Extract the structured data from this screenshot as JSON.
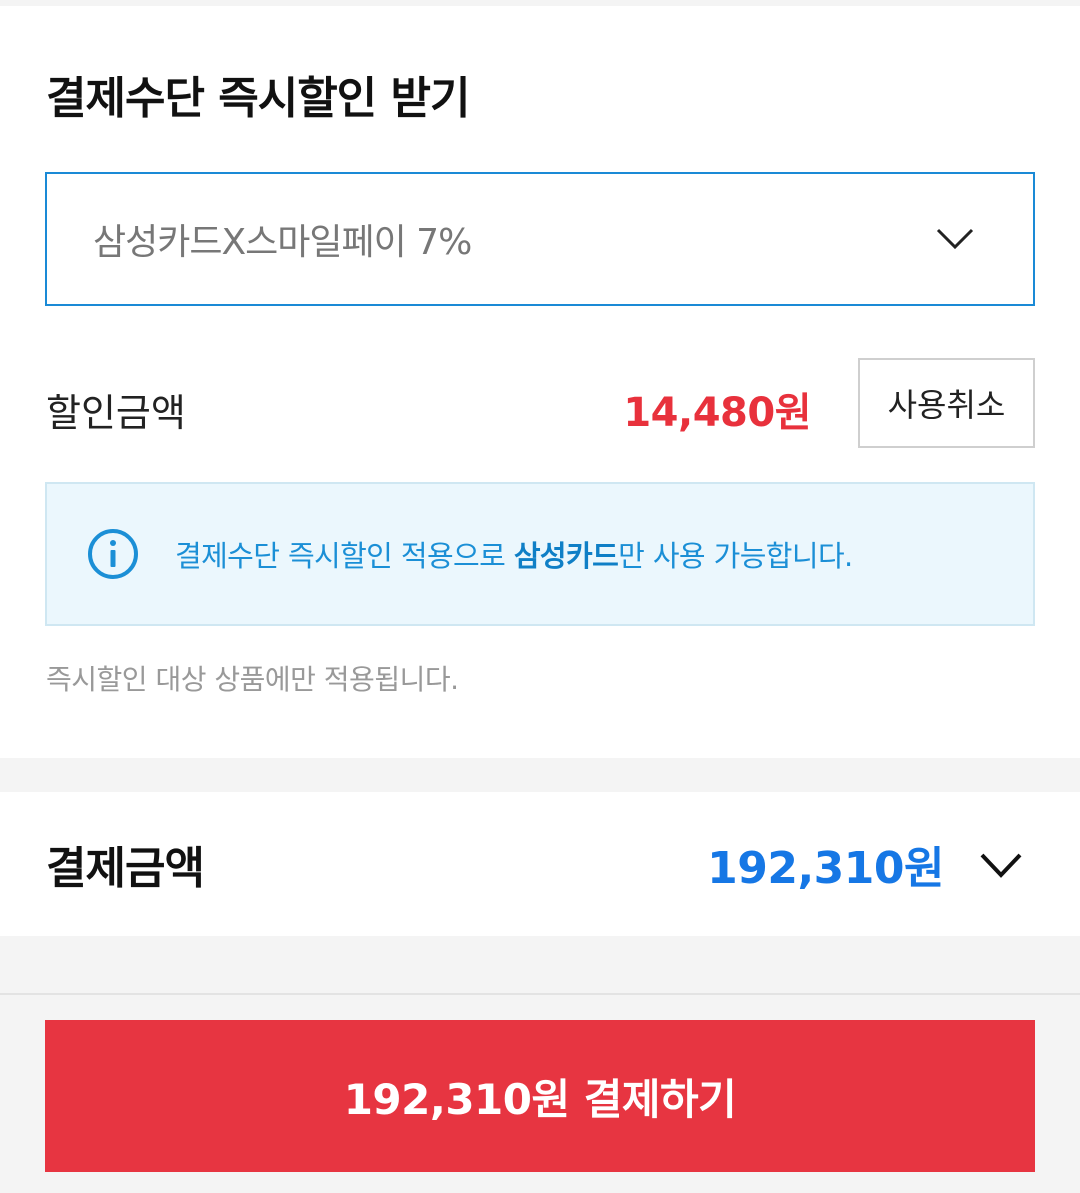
{
  "discount_section": {
    "title": "결제수단 즉시할인 받기",
    "select": {
      "value": "삼성카드X스마일페이 7%",
      "icon": "chevron-down-icon"
    },
    "discount_label": "할인금액",
    "discount_amount": "14,480원",
    "cancel_label": "사용취소",
    "info": {
      "icon": "info-icon",
      "text_before": "결제수단 즉시할인 적용으로 ",
      "text_bold": "삼성카드",
      "text_after": "만 사용 가능합니다."
    },
    "note": "즉시할인 대상 상품에만 적용됩니다."
  },
  "total_section": {
    "label": "결제금액",
    "amount": "192,310원",
    "icon": "chevron-down-icon"
  },
  "pay_button": {
    "label": "192,310원 결제하기"
  },
  "colors": {
    "accent_red": "#e73541",
    "discount_red": "#e8313c",
    "total_blue": "#1677e5",
    "info_blue": "#1b8fd6",
    "select_border": "#1a8ad6",
    "info_bg": "#ebf7fd"
  }
}
